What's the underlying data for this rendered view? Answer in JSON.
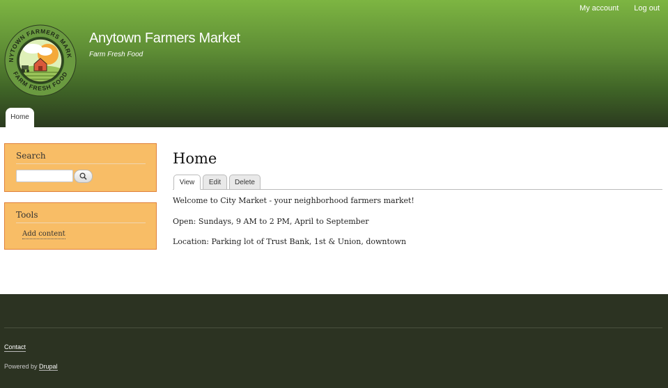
{
  "header": {
    "secondary_menu": [
      {
        "label": "My account"
      },
      {
        "label": "Log out"
      }
    ],
    "logo": {
      "ring_text_top": "ANYTOWN FARMERS MARKET",
      "ring_text_bottom": "FARM FRESH FOOD"
    },
    "site_name": "Anytown Farmers Market",
    "site_slogan": "Farm Fresh Food",
    "main_menu": [
      {
        "label": "Home"
      }
    ]
  },
  "sidebar": {
    "search": {
      "title": "Search",
      "input_value": "",
      "button_icon": "magnifier-icon"
    },
    "tools": {
      "title": "Tools",
      "links": [
        {
          "label": "Add content"
        }
      ]
    }
  },
  "main": {
    "title": "Home",
    "tabs": [
      {
        "label": "View",
        "active": true
      },
      {
        "label": "Edit",
        "active": false
      },
      {
        "label": "Delete",
        "active": false
      }
    ],
    "paragraphs": [
      "Welcome to City Market - your neighborhood farmers market!",
      "Open: Sundays, 9 AM to 2 PM, April to September",
      "Location: Parking lot of Trust Bank, 1st & Union, downtown"
    ]
  },
  "footer": {
    "contact_label": "Contact",
    "powered_prefix": "Powered by ",
    "powered_link": "Drupal"
  },
  "colors": {
    "header_top": "#7db542",
    "header_bottom": "#2b3a1f",
    "sidebar_block_bg": "#f8bd66",
    "sidebar_block_border": "#e0803a",
    "footer_bg": "#2c3322"
  }
}
